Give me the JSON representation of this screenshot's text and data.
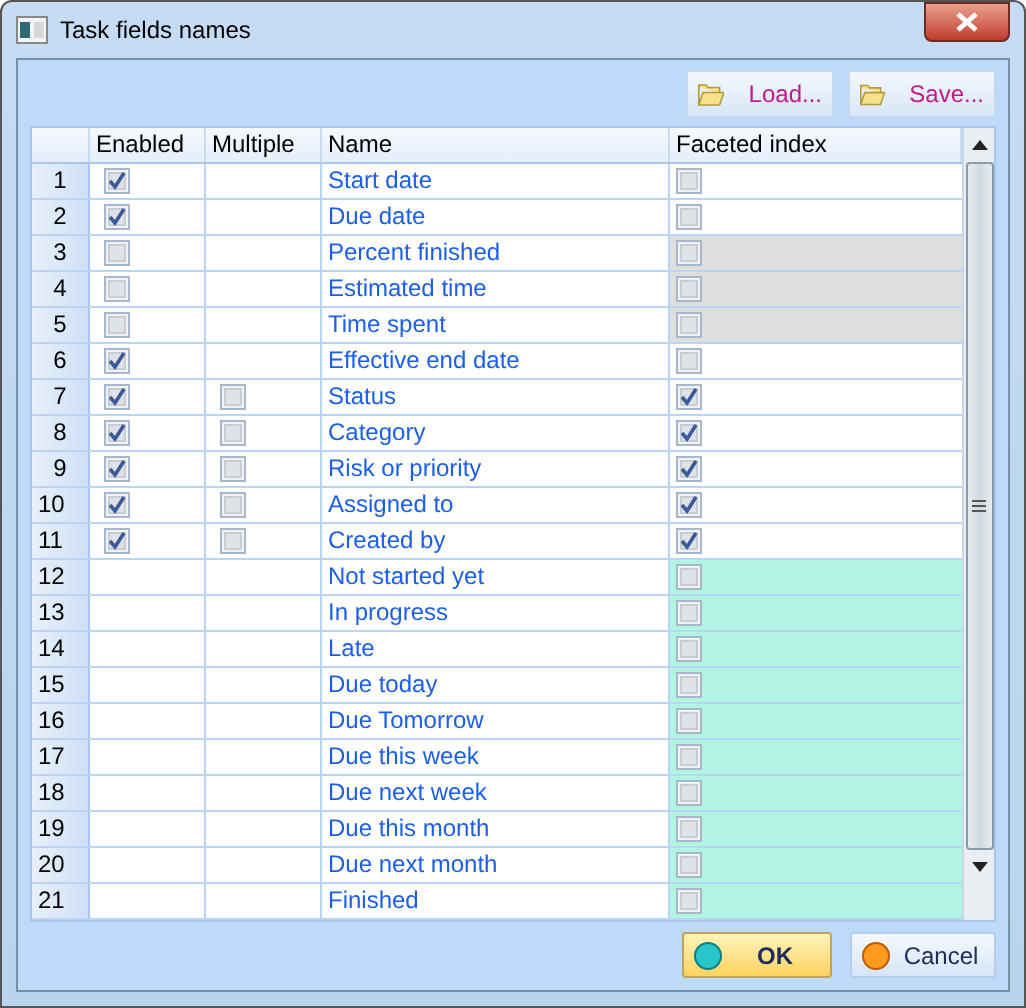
{
  "window": {
    "title": "Task fields names"
  },
  "toolbar": [
    {
      "label": "Load..."
    },
    {
      "label": "Save..."
    }
  ],
  "table": {
    "columns": [
      "Enabled",
      "Multiple",
      "Name",
      "Faceted index"
    ],
    "rows": [
      {
        "number": "1",
        "enabled": true,
        "name": "Start date",
        "faceted": false,
        "kind": "normal"
      },
      {
        "number": "2",
        "enabled": true,
        "name": "Due date",
        "faceted": false,
        "kind": "normal"
      },
      {
        "number": "3",
        "enabled": false,
        "name": "Percent finished",
        "faceted": false,
        "kind": "disabled"
      },
      {
        "number": "4",
        "enabled": false,
        "name": "Estimated time",
        "faceted": false,
        "kind": "disabled"
      },
      {
        "number": "5",
        "enabled": false,
        "name": "Time spent",
        "faceted": false,
        "kind": "disabled"
      },
      {
        "number": "6",
        "enabled": true,
        "name": "Effective end date",
        "faceted": false,
        "kind": "normal"
      },
      {
        "number": "7",
        "enabled": true,
        "multiple": false,
        "name": "Status",
        "faceted": true,
        "kind": "normal"
      },
      {
        "number": "8",
        "enabled": true,
        "multiple": false,
        "name": "Category",
        "faceted": true,
        "kind": "normal"
      },
      {
        "number": "9",
        "enabled": true,
        "multiple": false,
        "name": "Risk or priority",
        "faceted": true,
        "kind": "normal"
      },
      {
        "number": "10",
        "enabled": true,
        "multiple": false,
        "name": "Assigned to",
        "faceted": true,
        "kind": "normal"
      },
      {
        "number": "11",
        "enabled": true,
        "multiple": false,
        "name": "Created by",
        "faceted": true,
        "kind": "normal"
      },
      {
        "number": "12",
        "name": "Not started yet",
        "faceted": false,
        "kind": "status"
      },
      {
        "number": "13",
        "name": "In progress",
        "faceted": false,
        "kind": "status"
      },
      {
        "number": "14",
        "name": "Late",
        "faceted": false,
        "kind": "status"
      },
      {
        "number": "15",
        "name": "Due today",
        "faceted": false,
        "kind": "status"
      },
      {
        "number": "16",
        "name": "Due Tomorrow",
        "faceted": false,
        "kind": "status"
      },
      {
        "number": "17",
        "name": "Due this week",
        "faceted": false,
        "kind": "status"
      },
      {
        "number": "18",
        "name": "Due next week",
        "faceted": false,
        "kind": "status"
      },
      {
        "number": "19",
        "name": "Due this month",
        "faceted": false,
        "kind": "status"
      },
      {
        "number": "20",
        "name": "Due next month",
        "faceted": false,
        "kind": "status"
      },
      {
        "number": "21",
        "name": "Finished",
        "faceted": false,
        "kind": "status"
      }
    ]
  },
  "buttons": [
    {
      "label": "OK",
      "kind": "default"
    },
    {
      "label": "Cancel",
      "kind": "cancel"
    }
  ]
}
